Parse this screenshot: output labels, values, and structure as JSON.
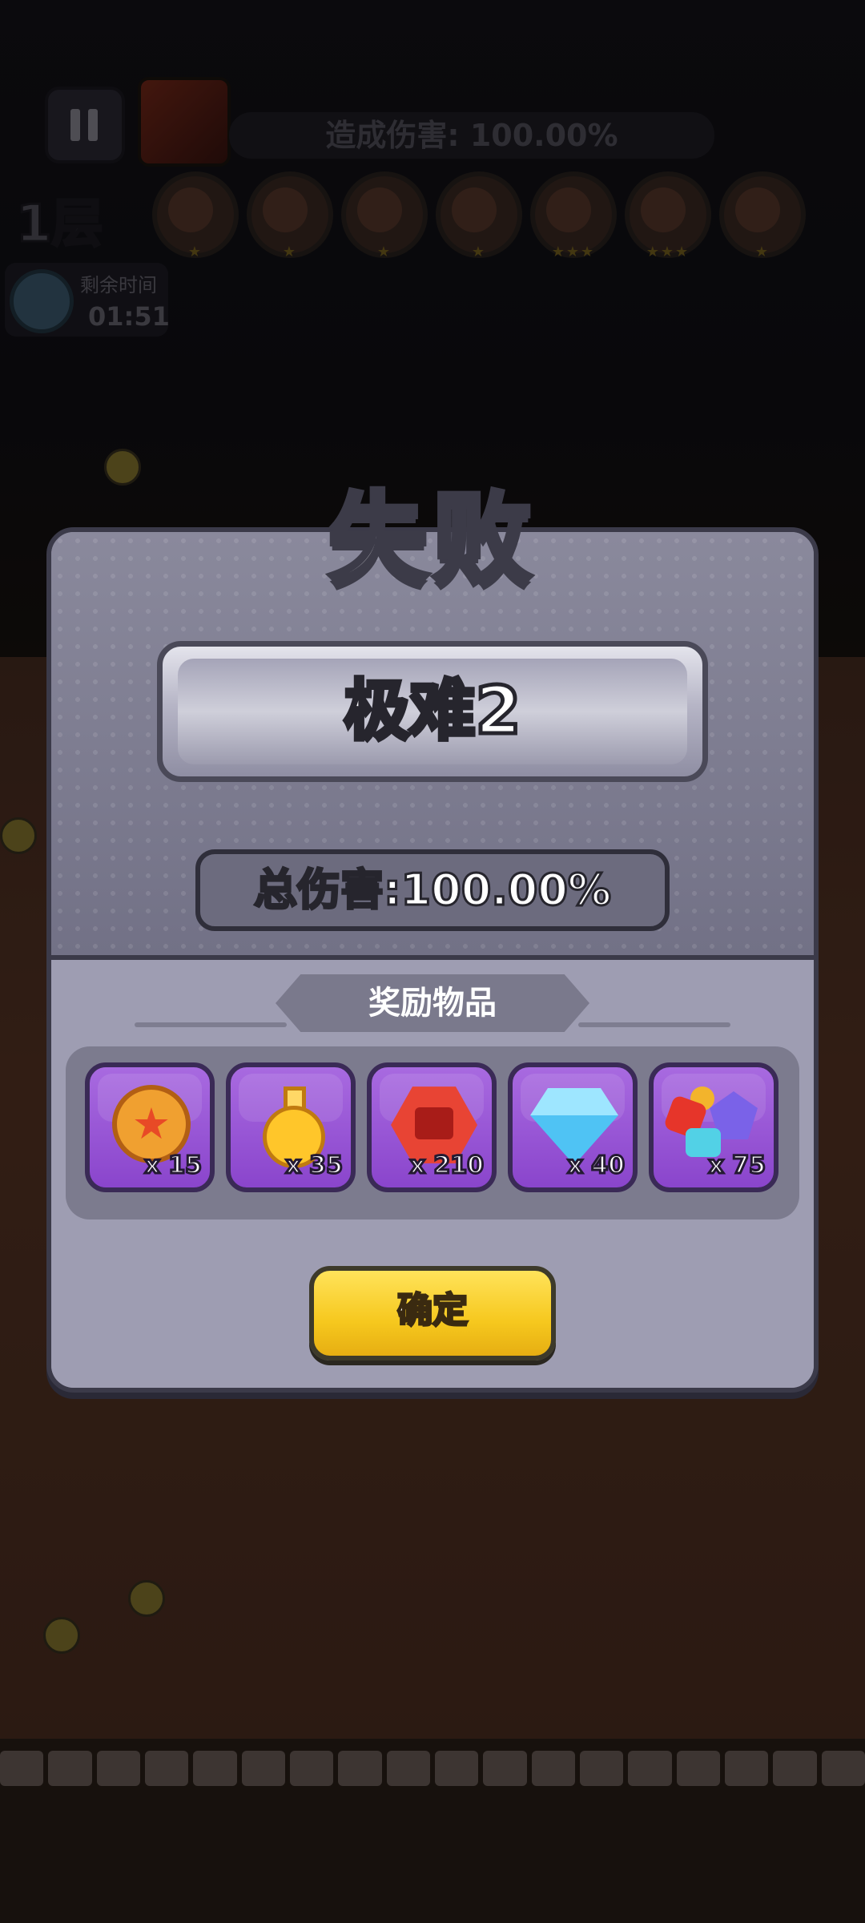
{
  "hud": {
    "damage_label": "造成伤害: 100.00%",
    "floor": "1层",
    "timer_label": "剩余时间",
    "timer_value": "01:51",
    "skills": [
      {
        "icon": "sword-skill-icon",
        "stars": "★"
      },
      {
        "icon": "skull-skill-icon",
        "stars": "★"
      },
      {
        "icon": "boot-skill-icon",
        "stars": "★"
      },
      {
        "icon": "arrow-up-skill-icon",
        "stars": "★"
      },
      {
        "icon": "pig-skill-icon",
        "stars": "★★★"
      },
      {
        "icon": "pill-skill-icon",
        "stars": "★★★"
      },
      {
        "icon": "lightning-skill-icon",
        "stars": "★"
      }
    ]
  },
  "dialog": {
    "title": "失败",
    "difficulty": "极难2",
    "total_damage": "总伤害:100.00%",
    "rewards_title": "奖励物品",
    "rewards": [
      {
        "icon": "star-coin-icon",
        "count": "x 15"
      },
      {
        "icon": "potion-icon",
        "count": "x 35"
      },
      {
        "icon": "red-hex-gem-icon",
        "count": "x 210"
      },
      {
        "icon": "diamond-icon",
        "count": "x 40"
      },
      {
        "icon": "gem-pile-icon",
        "count": "x 75"
      }
    ],
    "confirm_label": "确定"
  },
  "colors": {
    "panel": "#8f8ea0",
    "reward_slot": "#8a45cc",
    "confirm_button": "#f6c81e"
  }
}
